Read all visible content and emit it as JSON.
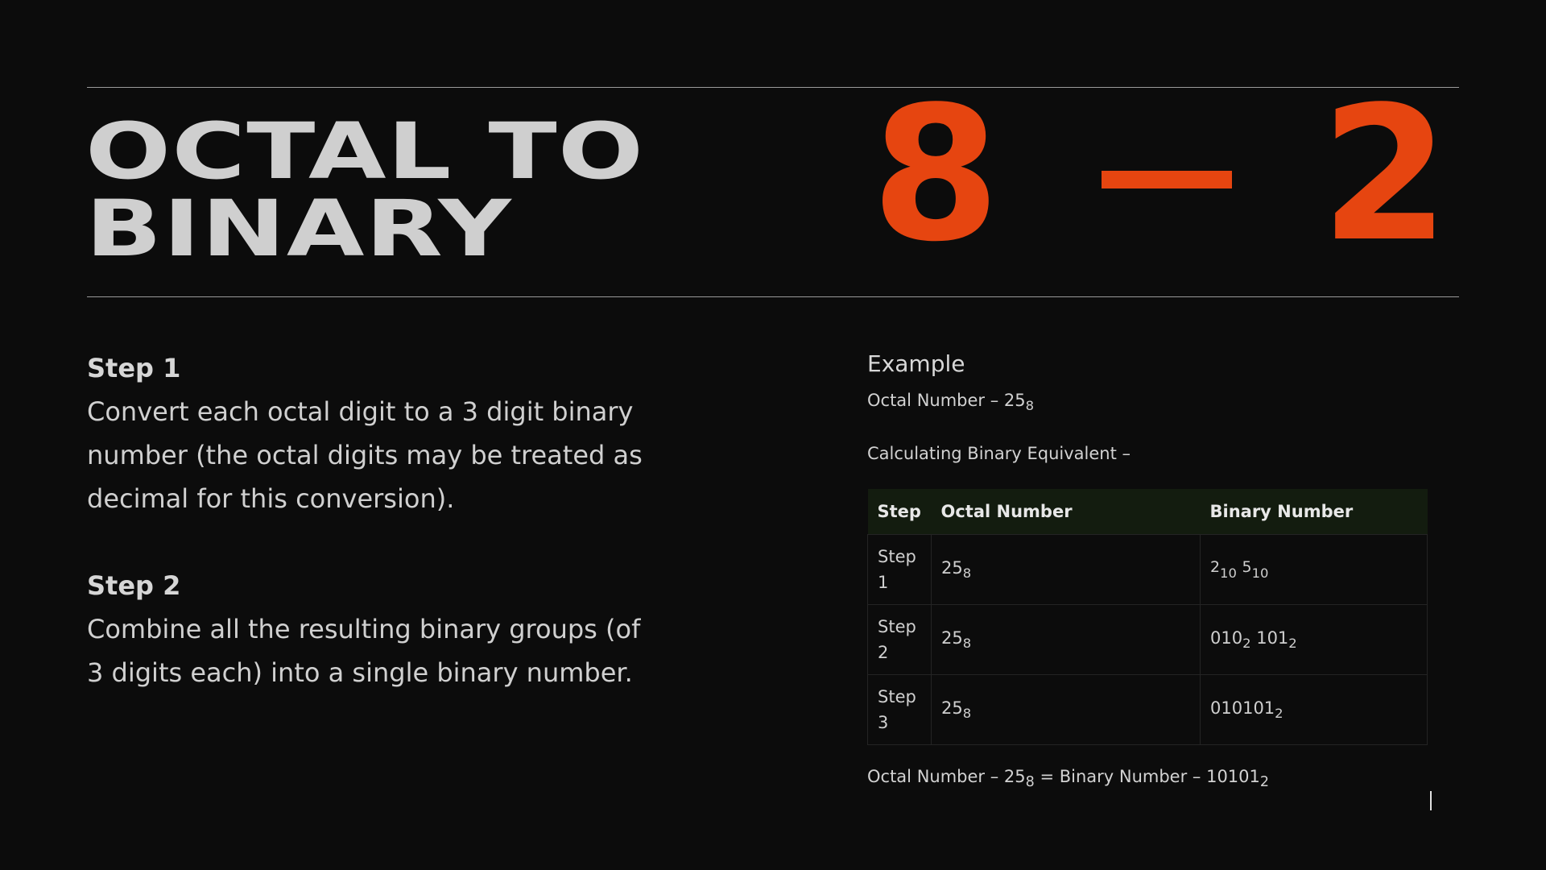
{
  "title": {
    "line1": "OCTAL TO",
    "line2": "BINARY"
  },
  "hero": {
    "left": "8",
    "right": "2"
  },
  "steps": [
    {
      "heading": "Step 1",
      "text": "Convert each octal digit to a 3 digit binary number (the octal digits may be treated as decimal for this conversion)."
    },
    {
      "heading": "Step 2",
      "text": "Combine all the resulting binary groups (of 3 digits each) into a single binary number."
    }
  ],
  "example": {
    "title": "Example",
    "octal_label": "Octal Number – 25",
    "octal_base": "8",
    "calc_label": "Calculating Binary Equivalent –",
    "table": {
      "headers": [
        "Step",
        "Octal Number",
        "Binary Number"
      ],
      "rows": [
        {
          "step": "Step 1",
          "octal": "25",
          "octal_base": "8",
          "binary_parts": [
            {
              "val": "2",
              "base": "10"
            },
            {
              "val": "5",
              "base": "10"
            }
          ]
        },
        {
          "step": "Step 2",
          "octal": "25",
          "octal_base": "8",
          "binary_parts": [
            {
              "val": "010",
              "base": "2"
            },
            {
              "val": "101",
              "base": "2"
            }
          ]
        },
        {
          "step": "Step 3",
          "octal": "25",
          "octal_base": "8",
          "binary_parts": [
            {
              "val": "010101",
              "base": "2"
            }
          ]
        }
      ]
    },
    "result": {
      "octal_label": "Octal Number – 25",
      "octal_base": "8",
      "binary_label": " = Binary Number – 10101",
      "binary_base": "2"
    }
  }
}
